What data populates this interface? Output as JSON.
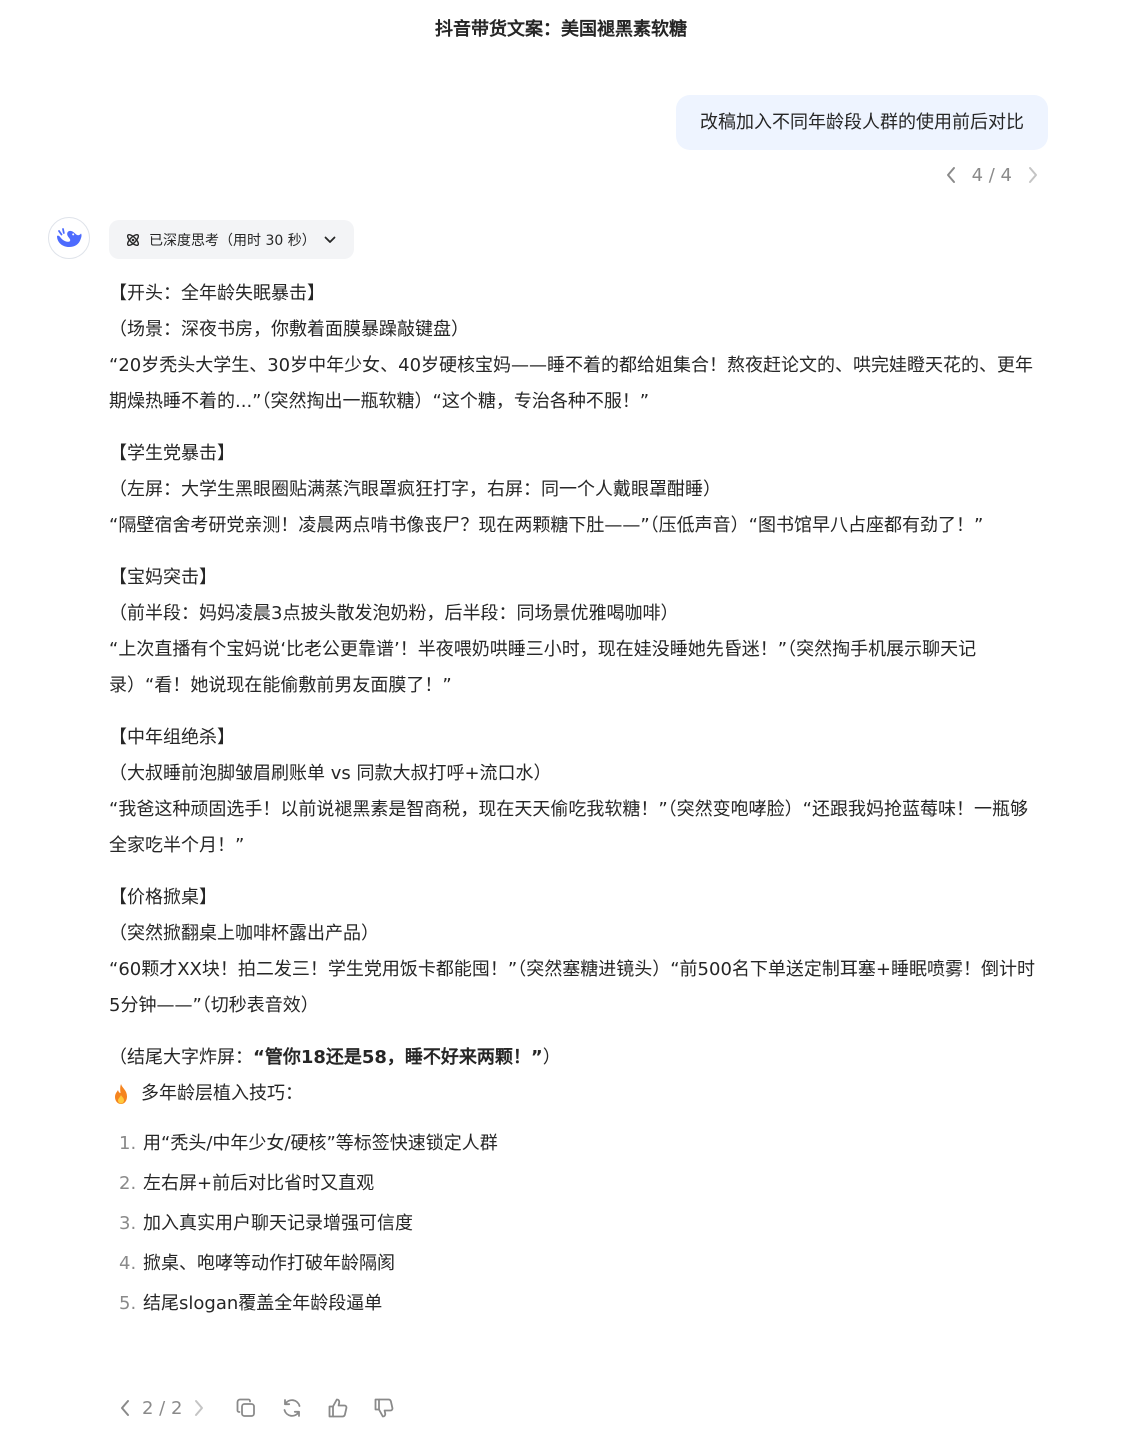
{
  "header": {
    "title": "抖音带货文案：美国褪黑素软糖"
  },
  "user_message": {
    "text": "改稿加入不同年龄段人群的使用前后对比",
    "pager": "4 / 4"
  },
  "assistant": {
    "thinking_label": "已深度思考（用时 30 秒）",
    "sections": [
      {
        "title": "【开头：全年龄失眠暴击】",
        "scene": "（场景：深夜书房，你敷着面膜暴躁敲键盘）",
        "line": "“20岁秃头大学生、30岁中年少女、40岁硬核宝妈——睡不着的都给姐集合！熬夜赶论文的、哄完娃瞪天花的、更年期燥热睡不着的...”（突然掏出一瓶软糖）“这个糖，专治各种不服！”"
      },
      {
        "title": "【学生党暴击】",
        "scene": "（左屏：大学生黑眼圈贴满蒸汽眼罩疯狂打字，右屏：同一个人戴眼罩酣睡）",
        "line": "“隔壁宿舍考研党亲测！凌晨两点啃书像丧尸？现在两颗糖下肚——”（压低声音）“图书馆早八占座都有劲了！”"
      },
      {
        "title": "【宝妈突击】",
        "scene": "（前半段：妈妈凌晨3点披头散发泡奶粉，后半段：同场景优雅喝咖啡）",
        "line": "“上次直播有个宝妈说‘比老公更靠谱’！半夜喂奶哄睡三小时，现在娃没睡她先昏迷！”（突然掏手机展示聊天记录）“看！她说现在能偷敷前男友面膜了！”"
      },
      {
        "title": "【中年组绝杀】",
        "scene": "（大叔睡前泡脚皱眉刷账单 vs 同款大叔打呼+流口水）",
        "line": "“我爸这种顽固选手！以前说褪黑素是智商税，现在天天偷吃我软糖！”（突然变咆哮脸）“还跟我妈抢蓝莓味！一瓶够全家吃半个月！”"
      },
      {
        "title": "【价格掀桌】",
        "scene": "（突然掀翻桌上咖啡杯露出产品）",
        "line": "“60颗才XX块！拍二发三！学生党用饭卡都能囤！”（突然塞糖进镜头）“前500名下单送定制耳塞+睡眠喷雾！倒计时5分钟——”（切秒表音效）"
      }
    ],
    "closing_prefix": "（结尾大字炸屏：",
    "closing_bold": "“管你18还是58，睡不好来两颗！”",
    "closing_suffix": "）",
    "tips_title": "多年龄层植入技巧：",
    "tips": [
      {
        "num": "1.",
        "text": "用“秃头/中年少女/硬核”等标签快速锁定人群"
      },
      {
        "num": "2.",
        "text": "左右屏+前后对比省时又直观"
      },
      {
        "num": "3.",
        "text": "加入真实用户聊天记录增强可信度"
      },
      {
        "num": "4.",
        "text": "掀桌、咆哮等动作打破年龄隔阂"
      },
      {
        "num": "5.",
        "text": "结尾slogan覆盖全年龄段逼单"
      }
    ],
    "pager": "2 / 2"
  },
  "icons": {
    "avatar": "deepseek-whale-icon",
    "thinking": "atom-icon",
    "tips": "fire-icon",
    "actions": [
      "copy-icon",
      "regenerate-icon",
      "thumbs-up-icon",
      "thumbs-down-icon"
    ]
  },
  "colors": {
    "user_bubble": "#eef4ff",
    "thinking_pill": "#f3f4f6",
    "brand": "#4d6bfe",
    "muted": "#8a8a8a",
    "text": "#262626"
  }
}
